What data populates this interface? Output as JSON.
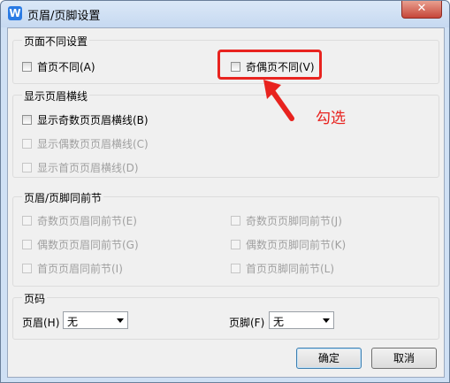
{
  "window": {
    "title": "页眉/页脚设置",
    "close_glyph": "✕",
    "app_glyph": "W"
  },
  "groups": {
    "diff": {
      "title": "页面不同设置",
      "first_page": "首页不同(A)",
      "odd_even": "奇偶页不同(V)"
    },
    "lines": {
      "title": "显示页眉横线",
      "odd": "显示奇数页页眉横线(B)",
      "even": "显示偶数页页眉横线(C)",
      "first": "显示首页页眉横线(D)"
    },
    "sync": {
      "title": "页眉/页脚同前节",
      "odd_header": "奇数页页眉同前节(E)",
      "even_header": "偶数页页眉同前节(G)",
      "first_header": "首页页眉同前节(I)",
      "odd_footer": "奇数页页脚同前节(J)",
      "even_footer": "偶数页页脚同前节(K)",
      "first_footer": "首页页脚同前节(L)"
    },
    "page_num": {
      "title": "页码",
      "header_label": "页眉(H)",
      "header_value": "无",
      "footer_label": "页脚(F)",
      "footer_value": "无"
    }
  },
  "buttons": {
    "ok": "确定",
    "cancel": "取消"
  },
  "annotation": {
    "text": "勾选",
    "color": "#e8231f"
  }
}
